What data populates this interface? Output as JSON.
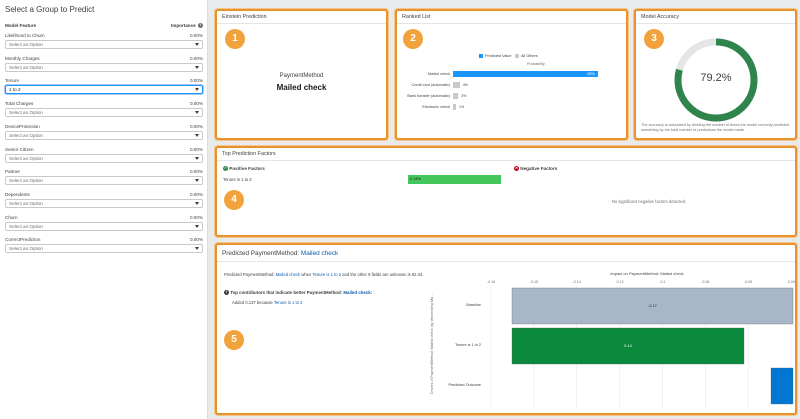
{
  "left": {
    "title": "Select a Group to Predict",
    "col_feature": "Model Feature",
    "col_importance": "Importance",
    "features": [
      {
        "label": "Likelihood to Churn",
        "pct": "0.00%",
        "value": "Select an Option",
        "active": false
      },
      {
        "label": "Monthly Charges",
        "pct": "0.00%",
        "value": "Select an Option",
        "active": false
      },
      {
        "label": "Tenure",
        "pct": "0.00%",
        "value": "1 to 2",
        "active": true
      },
      {
        "label": "Total Charges",
        "pct": "0.00%",
        "value": "Select an Option",
        "active": false
      },
      {
        "label": "DeviceProtection",
        "pct": "0.00%",
        "value": "Select an Option",
        "active": false
      },
      {
        "label": "Senior Citizen",
        "pct": "0.00%",
        "value": "Select an Option",
        "active": false
      },
      {
        "label": "Partner",
        "pct": "0.00%",
        "value": "Select an Option",
        "active": false
      },
      {
        "label": "Dependents",
        "pct": "0.00%",
        "value": "Select an Option",
        "active": false
      },
      {
        "label": "Churn",
        "pct": "0.00%",
        "value": "Select an Option",
        "active": false
      },
      {
        "label": "CorrectPrediction",
        "pct": "0.00%",
        "value": "Select an Option",
        "active": false
      }
    ]
  },
  "einstein": {
    "title": "Einstein Prediction",
    "badge": "1",
    "field": "PaymentMethod",
    "value": "Mailed check"
  },
  "ranked": {
    "title": "Ranked List",
    "badge": "2",
    "legend_predicted": "Predicted Value",
    "legend_others": "All Others",
    "axis_label": "Probability",
    "predicted_color": "#1b96ff",
    "other_color": "#c9c9c9",
    "rows": [
      {
        "label": "Mailed check",
        "value": 85,
        "text": "85%",
        "predicted": true
      },
      {
        "label": "Credit card (automatic)",
        "value": 4,
        "text": "4%",
        "predicted": false
      },
      {
        "label": "Bank transfer (automatic)",
        "value": 3,
        "text": "3%",
        "predicted": false
      },
      {
        "label": "Electronic check",
        "value": 1,
        "text": "1%",
        "predicted": false
      }
    ]
  },
  "accuracy": {
    "title": "Model Accuracy",
    "badge": "3",
    "value": 0.792,
    "text": "79.2%",
    "color": "#2e844a",
    "desc": "The accuracy is calculated by dividing the number of times the model correctly predicted something by the total number of predictions the model made."
  },
  "factors": {
    "title": "Top Prediction Factors",
    "badge": "4",
    "positive_title": "Positive Factors",
    "negative_title": "Negative Factors",
    "positive": [
      {
        "label": "Tenure is 1 to 2",
        "value": "0.14%"
      }
    ],
    "negative_empty": "No significant negative factors detected.",
    "positive_color": "#45c65a"
  },
  "predicted": {
    "title_prefix": "Predicted PaymentMethod:",
    "title_value": "Mailed check",
    "badge": "5",
    "summary_a": "Predicted PaymentMethod:",
    "summary_b": "Mailed check",
    "summary_c": "when",
    "summary_d": "Tenure is 1 to 2",
    "summary_e": "and the other 9 fields are unknown is 92.34.",
    "contrib_a": "Top contributors that indicate better PaymentMethod:",
    "contrib_b": "Mailed check:",
    "added_a": "Added 0.137 because",
    "added_b": "Tenure is 1 to 2"
  },
  "chart_data": {
    "type": "bar",
    "title": "Impact on PaymentMethod: Mailed check",
    "ylabel": "Drivers of PaymentMethod: Mailed check (by descending Ma...",
    "x_ticks": [
      "-0.16",
      "-0.15",
      "-0.14",
      "-0.12",
      "-0.1",
      "-0.08",
      "-0.06",
      "-0.04"
    ],
    "categories": [
      "Baseline",
      "Tenure is 1 to 2",
      "Predicted Outcome"
    ],
    "values": [
      -0.17,
      0.14,
      null
    ],
    "labels": [
      "-0.17",
      "0.14",
      ""
    ],
    "colors": [
      "#a8b7c7",
      "#0b8a3e",
      "#0176d3"
    ]
  }
}
